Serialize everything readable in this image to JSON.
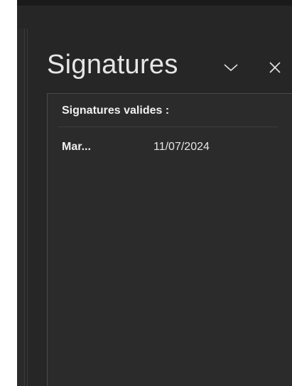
{
  "panel": {
    "title": "Signatures",
    "section_heading": "Signatures valides :",
    "signatures": [
      {
        "name": "Mar...",
        "date": "11/07/2024"
      }
    ]
  },
  "icons": {
    "collapse": "chevron-down-icon",
    "close": "close-icon"
  },
  "colors": {
    "background": "#262626",
    "panel_body": "#2b2b2b",
    "text": "#e6e6e6"
  }
}
